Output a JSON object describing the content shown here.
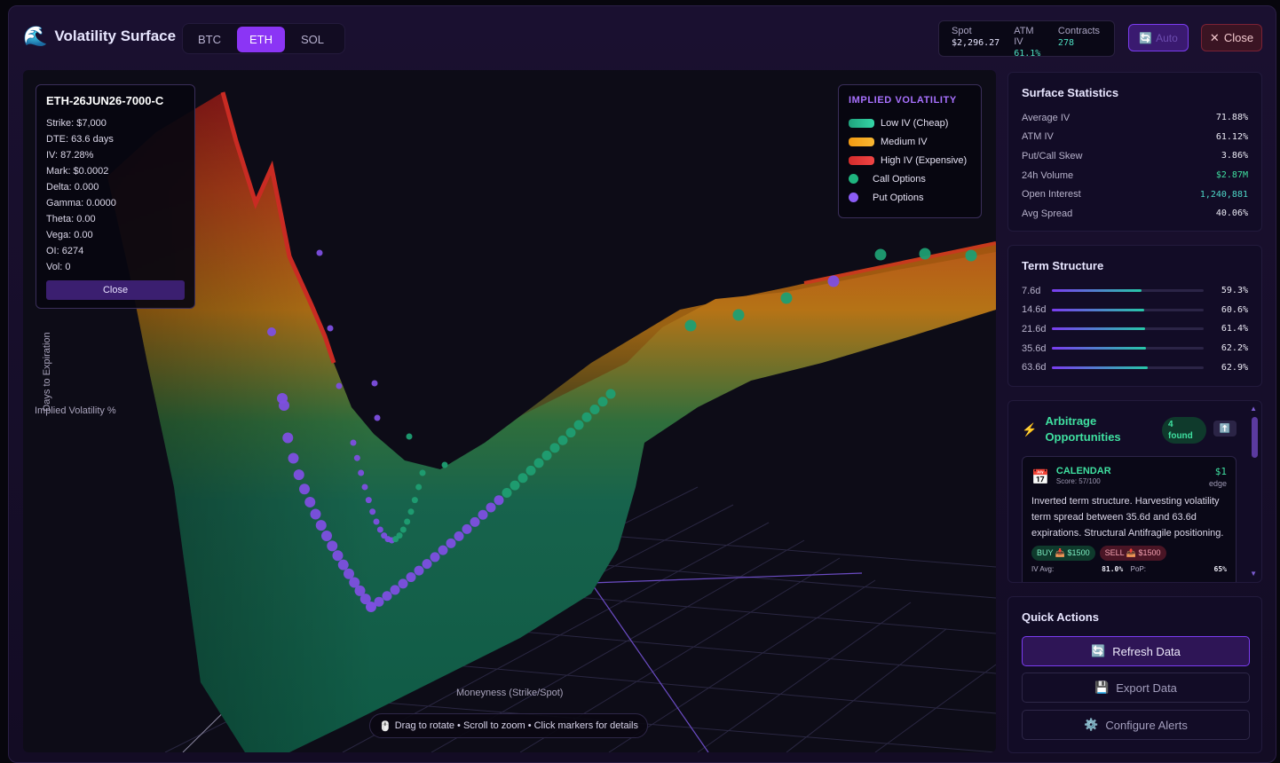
{
  "header": {
    "brand_icon": "wave-icon",
    "title": "Volatility Surface",
    "tabs": [
      {
        "label": "BTC",
        "active": false
      },
      {
        "label": "ETH",
        "active": true
      },
      {
        "label": "SOL",
        "active": false
      }
    ],
    "stats": {
      "spot_label": "Spot",
      "spot_value": "$2,296.27",
      "atm_label": "ATM IV",
      "atm_value": "61.1%",
      "contracts_label": "Contracts",
      "contracts_value": "278"
    },
    "auto_label": "Auto",
    "close_label": "Close"
  },
  "viewport": {
    "detail": {
      "title": "ETH-26JUN26-7000-C",
      "rows": [
        "Strike: $7,000",
        "DTE: 63.6 days",
        "IV: 87.28%",
        "Mark: $0.0002",
        "Delta: 0.000",
        "Gamma: 0.0000",
        "Theta: 0.00",
        "Vega: 0.00",
        "OI: 6274",
        "Vol: 0"
      ],
      "close_label": "Close"
    },
    "legend": {
      "title": "IMPLIED VOLATILITY",
      "items": [
        {
          "label": "Low IV (Cheap)",
          "color": "#22c79a"
        },
        {
          "label": "Medium IV",
          "color": "#f5a623"
        },
        {
          "label": "High IV (Expensive)",
          "color": "#e53939"
        },
        {
          "label": "Call Options",
          "color": "#1fb47f"
        },
        {
          "label": "Put Options",
          "color": "#8b5cf6"
        }
      ]
    },
    "axis_days": "Days to Expiration",
    "axis_iv": "Implied Volatility %",
    "axis_moneyness": "Moneyness (Strike/Spot)",
    "hint": "Drag to rotate • Scroll to zoom • Click markers for details"
  },
  "surface_stats": {
    "title": "Surface Statistics",
    "rows": [
      {
        "label": "Average IV",
        "value": "71.88%"
      },
      {
        "label": "ATM IV",
        "value": "61.12%"
      },
      {
        "label": "Put/Call Skew",
        "value": "3.86%"
      },
      {
        "label": "24h Volume",
        "value": "$2.87M"
      },
      {
        "label": "Open Interest",
        "value": "1,240,881"
      },
      {
        "label": "Avg Spread",
        "value": "40.06%"
      }
    ]
  },
  "term_structure": {
    "title": "Term Structure",
    "rows": [
      {
        "label": "7.6d",
        "value": "59.3%",
        "fill": 0.593
      },
      {
        "label": "14.6d",
        "value": "60.6%",
        "fill": 0.606
      },
      {
        "label": "21.6d",
        "value": "61.4%",
        "fill": 0.614
      },
      {
        "label": "35.6d",
        "value": "62.2%",
        "fill": 0.622
      },
      {
        "label": "63.6d",
        "value": "62.9%",
        "fill": 0.629
      }
    ]
  },
  "arbitrage": {
    "title": "Arbitrage Opportunities",
    "badge": "4 found",
    "card": {
      "type": "CALENDAR",
      "score": "Score: 57/100",
      "edge_value": "$1",
      "edge_label": "edge",
      "description": "Inverted term structure. Harvesting volatility term spread between 35.6d and 63.6d expirations. Structural Antifragile positioning.",
      "buy_tag": "BUY 📥 $1500",
      "sell_tag": "SELL 📤 $1500",
      "iv_avg_label": "IV Avg:",
      "iv_avg_value": "81.0%",
      "pop_label": "PoP:",
      "pop_value": "65%"
    }
  },
  "quick_actions": {
    "title": "Quick Actions",
    "refresh": "Refresh Data",
    "export": "Export Data",
    "alerts": "Configure Alerts"
  }
}
